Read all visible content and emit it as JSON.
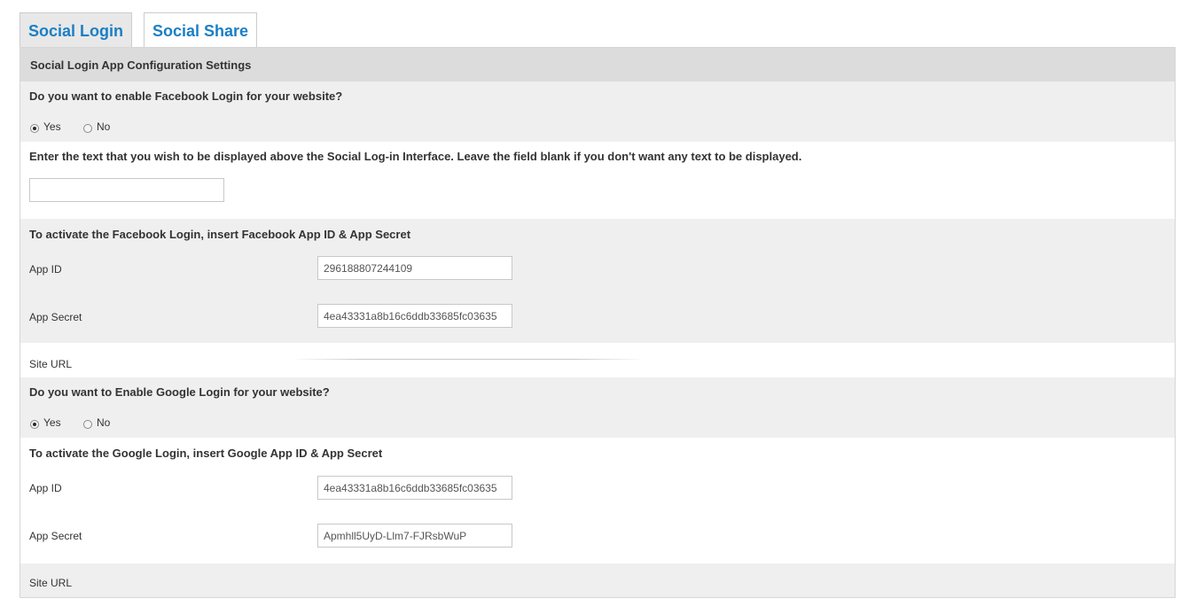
{
  "tabs": [
    {
      "label": "Social Login",
      "active": true
    },
    {
      "label": "Social Share",
      "active": false
    }
  ],
  "panel_title": "Social Login App Configuration Settings",
  "facebook": {
    "enable_question": "Do you want to enable Facebook Login for your website?",
    "yes_label": "Yes",
    "no_label": "No",
    "selected": "Yes",
    "display_text_prompt": "Enter the text that you wish to be displayed above the Social Log-in Interface. Leave the field blank if you don't want any text to be displayed.",
    "display_text_value": "",
    "activate_heading": "To activate the Facebook Login, insert Facebook App ID & App Secret",
    "app_id_label": "App ID",
    "app_id_value": "296188807244109",
    "app_secret_label": "App Secret",
    "app_secret_value": "4ea43331a8b16c6ddb33685fc03635",
    "site_url_label": "Site URL"
  },
  "google": {
    "enable_question": "Do you want to Enable Google Login for your website?",
    "yes_label": "Yes",
    "no_label": "No",
    "selected": "Yes",
    "activate_heading": "To activate the Google Login, insert Google App ID & App Secret",
    "app_id_label": "App ID",
    "app_id_value": "4ea43331a8b16c6ddb33685fc03635",
    "app_secret_label": "App Secret",
    "app_secret_value": "Apmhll5UyD-Llm7-FJRsbWuP",
    "site_url_label": "Site URL"
  },
  "colors": {
    "tab_text": "#1a7fc4",
    "header_band": "#dcdcdc",
    "gray_band": "#efefef"
  }
}
